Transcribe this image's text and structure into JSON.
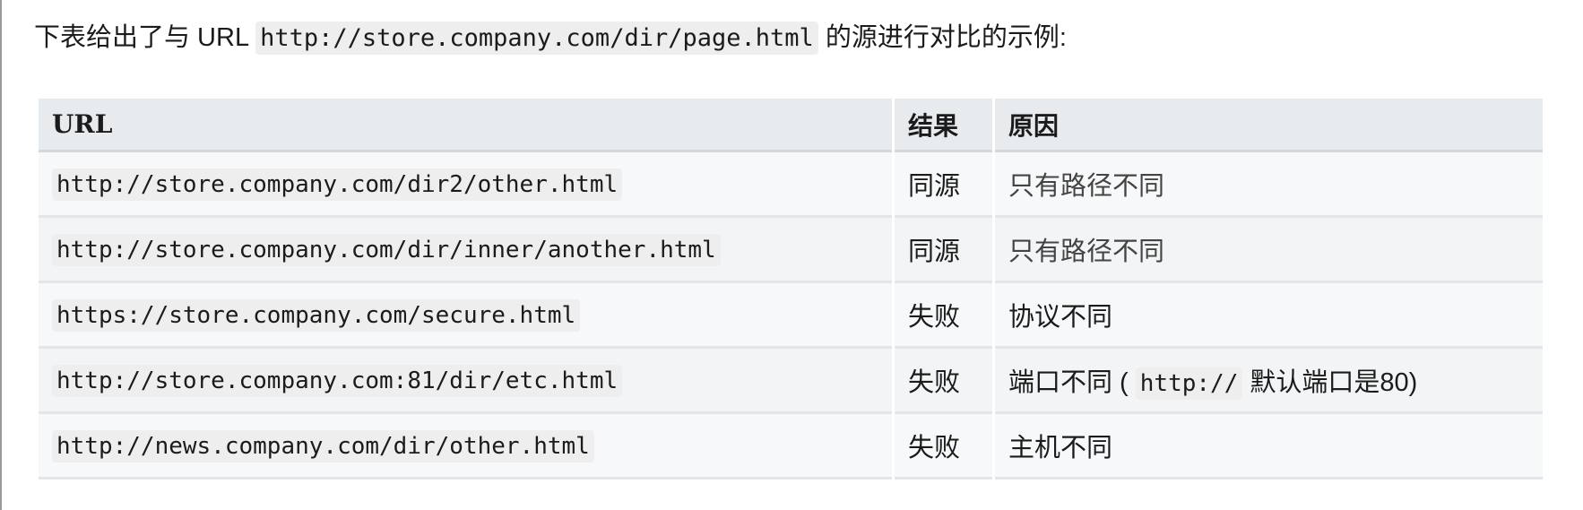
{
  "intro": {
    "prefix": "下表给出了与 URL ",
    "code": "http://store.company.com/dir/page.html",
    "suffix": " 的源进行对比的示例:"
  },
  "table": {
    "headers": [
      "URL",
      "结果",
      "原因"
    ],
    "rows": [
      {
        "url": "http://store.company.com/dir2/other.html",
        "result": "同源",
        "reason": "只有路径不同"
      },
      {
        "url": "http://store.company.com/dir/inner/another.html",
        "result": "同源",
        "reason": "只有路径不同"
      },
      {
        "url": "https://store.company.com/secure.html",
        "result": "失败",
        "reason": "协议不同"
      },
      {
        "url": "http://store.company.com:81/dir/etc.html",
        "result": "失败",
        "reason_prefix": "端口不同 ( ",
        "reason_code": "http://",
        "reason_suffix": " 默认端口是80)"
      },
      {
        "url": "http://news.company.com/dir/other.html",
        "result": "失败",
        "reason": "主机不同"
      }
    ]
  }
}
